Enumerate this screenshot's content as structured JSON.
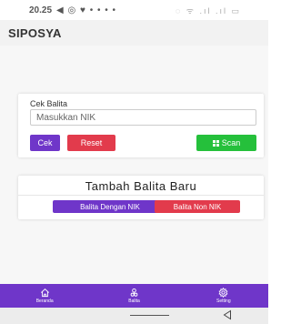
{
  "status": {
    "time": "20.25"
  },
  "app": {
    "title": "SIPOSYA"
  },
  "cek_card": {
    "label": "Cek Balita",
    "placeholder": "Masukkan NIK",
    "cek_label": "Cek",
    "reset_label": "Reset",
    "scan_label": "Scan"
  },
  "tambah_card": {
    "heading": "Tambah Balita Baru",
    "nik_label": "Balita Dengan NIK",
    "non_nik_label": "Balita Non NIK"
  },
  "nav": [
    {
      "label": "Beranda",
      "icon": "home-icon"
    },
    {
      "label": "Balita",
      "icon": "baby-icon"
    },
    {
      "label": "Setting",
      "icon": "gear-icon"
    }
  ],
  "colors": {
    "primary": "#6f36c9",
    "danger": "#e23b4c",
    "success": "#25c03b"
  }
}
